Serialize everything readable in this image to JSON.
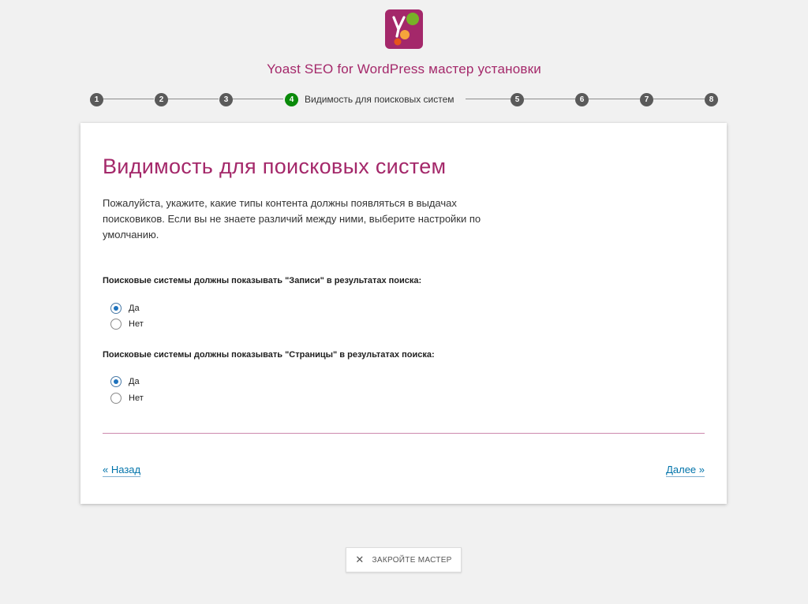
{
  "app": {
    "title": "Yoast SEO for WordPress мастер установки"
  },
  "stepper": {
    "steps": [
      {
        "number": "1",
        "label": ""
      },
      {
        "number": "2",
        "label": ""
      },
      {
        "number": "3",
        "label": ""
      },
      {
        "number": "4",
        "label": "Видимость для поисковых систем"
      },
      {
        "number": "5",
        "label": ""
      },
      {
        "number": "6",
        "label": ""
      },
      {
        "number": "7",
        "label": ""
      },
      {
        "number": "8",
        "label": ""
      }
    ],
    "active_step": 4
  },
  "card": {
    "title": "Видимость для поисковых систем",
    "description": "Пожалуйста, укажите, какие типы контента должны появляться в выдачах поисковиков. Если вы не знаете различий между ними, выберите настройки по умолчанию.",
    "questions": [
      {
        "text": "Поисковые системы должны показывать \"Записи\" в результатах поиска:",
        "options": [
          {
            "label": "Да",
            "checked": true
          },
          {
            "label": "Нет",
            "checked": false
          }
        ]
      },
      {
        "text": "Поисковые системы должны показывать \"Страницы\" в результатах поиска:",
        "options": [
          {
            "label": "Да",
            "checked": true
          },
          {
            "label": "Нет",
            "checked": false
          }
        ]
      }
    ],
    "back_label": "« Назад",
    "next_label": "Далее »"
  },
  "footer": {
    "close_label": "ЗАКРОЙТЕ МАСТЕР"
  },
  "colors": {
    "brand": "#a4286a",
    "active_step": "#0a8a0a",
    "link": "#0073aa"
  },
  "icons": {
    "logo": "yoast-logo-icon",
    "close": "close-icon"
  }
}
